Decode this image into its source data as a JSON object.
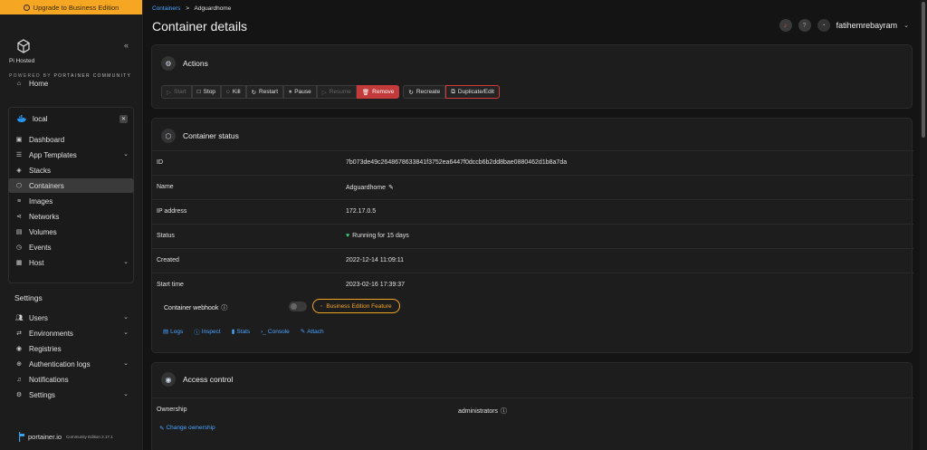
{
  "upgrade_banner": "Upgrade to Business Edition",
  "brand": {
    "instance_name": "Pi Hosted",
    "powered_by_prefix": "POWERED BY",
    "powered_by_name": "PORTAINER COMMUNITY",
    "footer_logo": "portainer.io",
    "footer_edition": "Community Edition 2.17.1"
  },
  "sidebar": {
    "home": "Home",
    "environment": {
      "name": "local",
      "items": [
        {
          "label": "Dashboard",
          "icon": "dashboard-icon"
        },
        {
          "label": "App Templates",
          "icon": "app-templates-icon"
        },
        {
          "label": "Stacks",
          "icon": "stacks-icon"
        },
        {
          "label": "Containers",
          "icon": "containers-icon"
        },
        {
          "label": "Images",
          "icon": "images-icon"
        },
        {
          "label": "Networks",
          "icon": "networks-icon"
        },
        {
          "label": "Volumes",
          "icon": "volumes-icon"
        },
        {
          "label": "Events",
          "icon": "events-icon"
        },
        {
          "label": "Host",
          "icon": "host-icon"
        }
      ]
    },
    "settings_title": "Settings",
    "settings_items": [
      {
        "label": "Users"
      },
      {
        "label": "Environments"
      },
      {
        "label": "Registries"
      },
      {
        "label": "Authentication logs"
      },
      {
        "label": "Notifications"
      },
      {
        "label": "Settings"
      }
    ]
  },
  "breadcrumb": {
    "parent": "Containers",
    "separator": ">",
    "current": "Adguardhome"
  },
  "page_title": "Container details",
  "user": {
    "name": "fatihemrebayram"
  },
  "actions": {
    "title": "Actions",
    "buttons": {
      "start": "Start",
      "stop": "Stop",
      "kill": "Kill",
      "restart": "Restart",
      "pause": "Pause",
      "resume": "Resume",
      "remove": "Remove",
      "recreate": "Recreate",
      "duplicate": "Duplicate/Edit"
    }
  },
  "container_status": {
    "title": "Container status",
    "rows": [
      {
        "key": "ID",
        "value": "7b073de49c2648678633841f3752ea6447f0dccb6b2dd8bae0880462d1b8a7da"
      },
      {
        "key": "Name",
        "value": "Adguardhome"
      },
      {
        "key": "IP address",
        "value": "172.17.0.5"
      },
      {
        "key": "Status",
        "value": "Running for 15 days"
      },
      {
        "key": "Created",
        "value": "2022-12-14 11:09:11"
      },
      {
        "key": "Start time",
        "value": "2023-02-16 17:39:37"
      }
    ],
    "webhook_label": "Container webhook",
    "be_feature": "Business Edition Feature",
    "links": {
      "logs": "Logs",
      "inspect": "Inspect",
      "stats": "Stats",
      "console": "Console",
      "attach": "Attach"
    }
  },
  "access_control": {
    "title": "Access control",
    "ownership_label": "Ownership",
    "ownership_value": "administrators",
    "change_ownership": "Change ownership"
  },
  "colors": {
    "accent": "#4aa3ff",
    "upgrade": "#f5a623",
    "danger": "#c23a3a",
    "running": "#3ecf6e"
  }
}
